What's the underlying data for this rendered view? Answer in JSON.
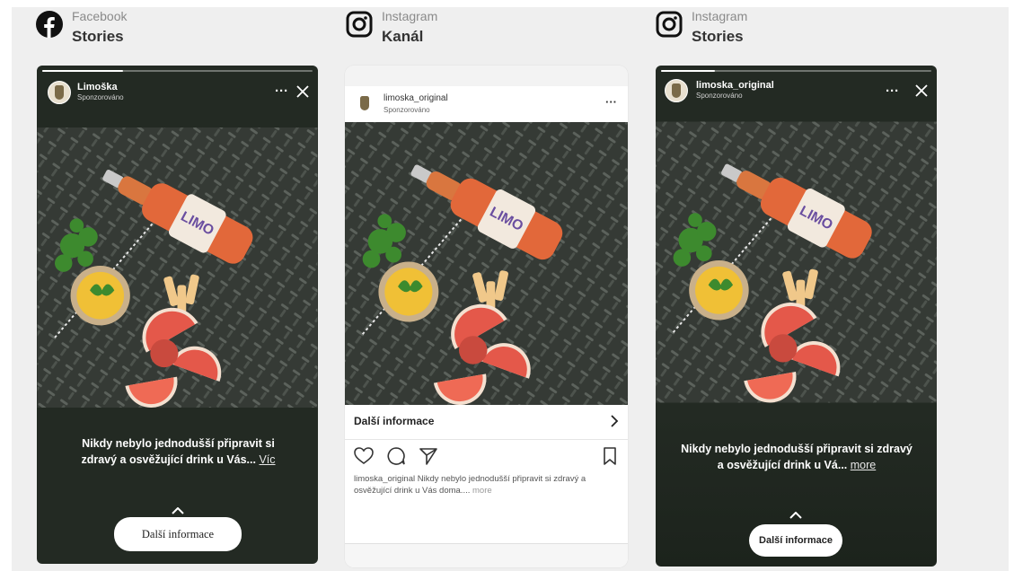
{
  "platforms": [
    {
      "name": "Facebook",
      "format": "Stories",
      "icon": "facebook-icon"
    },
    {
      "name": "Instagram",
      "format": "Kanál",
      "icon": "instagram-icon"
    },
    {
      "name": "Instagram",
      "format": "Stories",
      "icon": "instagram-icon"
    }
  ],
  "fb_story": {
    "username": "Limoška",
    "sponsored": "Sponzorováno",
    "caption": "Nikdy nebylo jednodušší připravit si zdravý a osvěžující drink u Vás...",
    "caption_link": "Víc",
    "cta": "Další informace",
    "progress": 0.3
  },
  "ig_feed": {
    "username": "limoska_original",
    "sponsored": "Sponzorováno",
    "more_info": "Další informace",
    "caption_user": "limoska_original",
    "caption": "Nikdy nebylo jednodušší připravit si zdravý a osvěžující drink u Vás doma....",
    "caption_more": "more"
  },
  "ig_story": {
    "username": "limoska_original",
    "sponsored": "Sponzorováno",
    "caption": "Nikdy nebylo jednodušší připravit si zdravý a osvěžující drink u Vá...",
    "caption_link": "more",
    "cta": "Další informace",
    "progress": 0.2
  },
  "colors": {
    "story_bg": "#232a23",
    "page_bg": "#efefef",
    "plate": "#3a3e3a",
    "juice": "#e2683a",
    "grapefruit": "#e4584a",
    "lemon": "#f0c036",
    "mint": "#3d8a2e"
  }
}
